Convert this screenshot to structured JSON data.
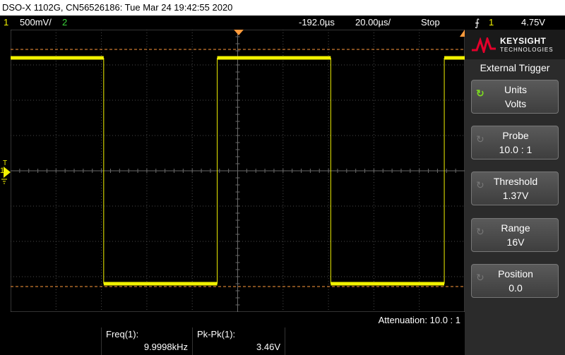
{
  "title": "DSO-X 1102G, CN56526186: Tue Mar 24 19:42:55 2020",
  "status": {
    "ch1_num": "1",
    "ch1_scale": "500mV/",
    "ch2_num": "2",
    "delay": "-192.0us",
    "timebase": "20.00us/",
    "run_state": "Stop",
    "trig_icon": "trigger-edge-icon",
    "trig_channel": "1",
    "trig_level": "4.75V"
  },
  "markers": {
    "ch1_ground": "1",
    "trigger_level": "T"
  },
  "brand": {
    "name": "KEYSIGHT",
    "sub": "TECHNOLOGIES"
  },
  "panel": {
    "title": "External Trigger",
    "keys": [
      {
        "line1": "Units",
        "line2": "Volts",
        "active": true
      },
      {
        "line1": "Probe",
        "line2": "10.0 : 1",
        "active": false
      },
      {
        "line1": "Threshold",
        "line2": "1.37V",
        "active": false
      },
      {
        "line1": "Range",
        "line2": "16V",
        "active": false
      },
      {
        "line1": "Position",
        "line2": "0.0",
        "active": false
      }
    ]
  },
  "attenuation": "Attenuation: 10.0 : 1",
  "measurements": [
    {
      "name": "Freq(1):",
      "value": "9.9998kHz"
    },
    {
      "name": "Pk-Pk(1):",
      "value": "3.46V"
    }
  ],
  "colors": {
    "ch1": "#f2f200",
    "ch2": "#3ad43a",
    "trigger": "#ff9a3c",
    "grid": "#4a4a4a"
  },
  "chart_data": {
    "type": "line",
    "xlabel": "",
    "ylabel": "",
    "series": [
      {
        "points": [
          [
            0.0,
            2.0
          ],
          [
            0.205,
            2.0
          ],
          [
            0.205,
            -2.0
          ],
          [
            0.455,
            -2.0
          ],
          [
            0.455,
            2.0
          ],
          [
            0.705,
            2.0
          ],
          [
            0.705,
            -2.0
          ],
          [
            0.955,
            -2.0
          ],
          [
            0.955,
            2.0
          ],
          [
            1.0,
            2.0
          ]
        ]
      }
    ],
    "xlim": [
      0,
      1
    ],
    "ylim": [
      -2.5,
      2.5
    ]
  }
}
